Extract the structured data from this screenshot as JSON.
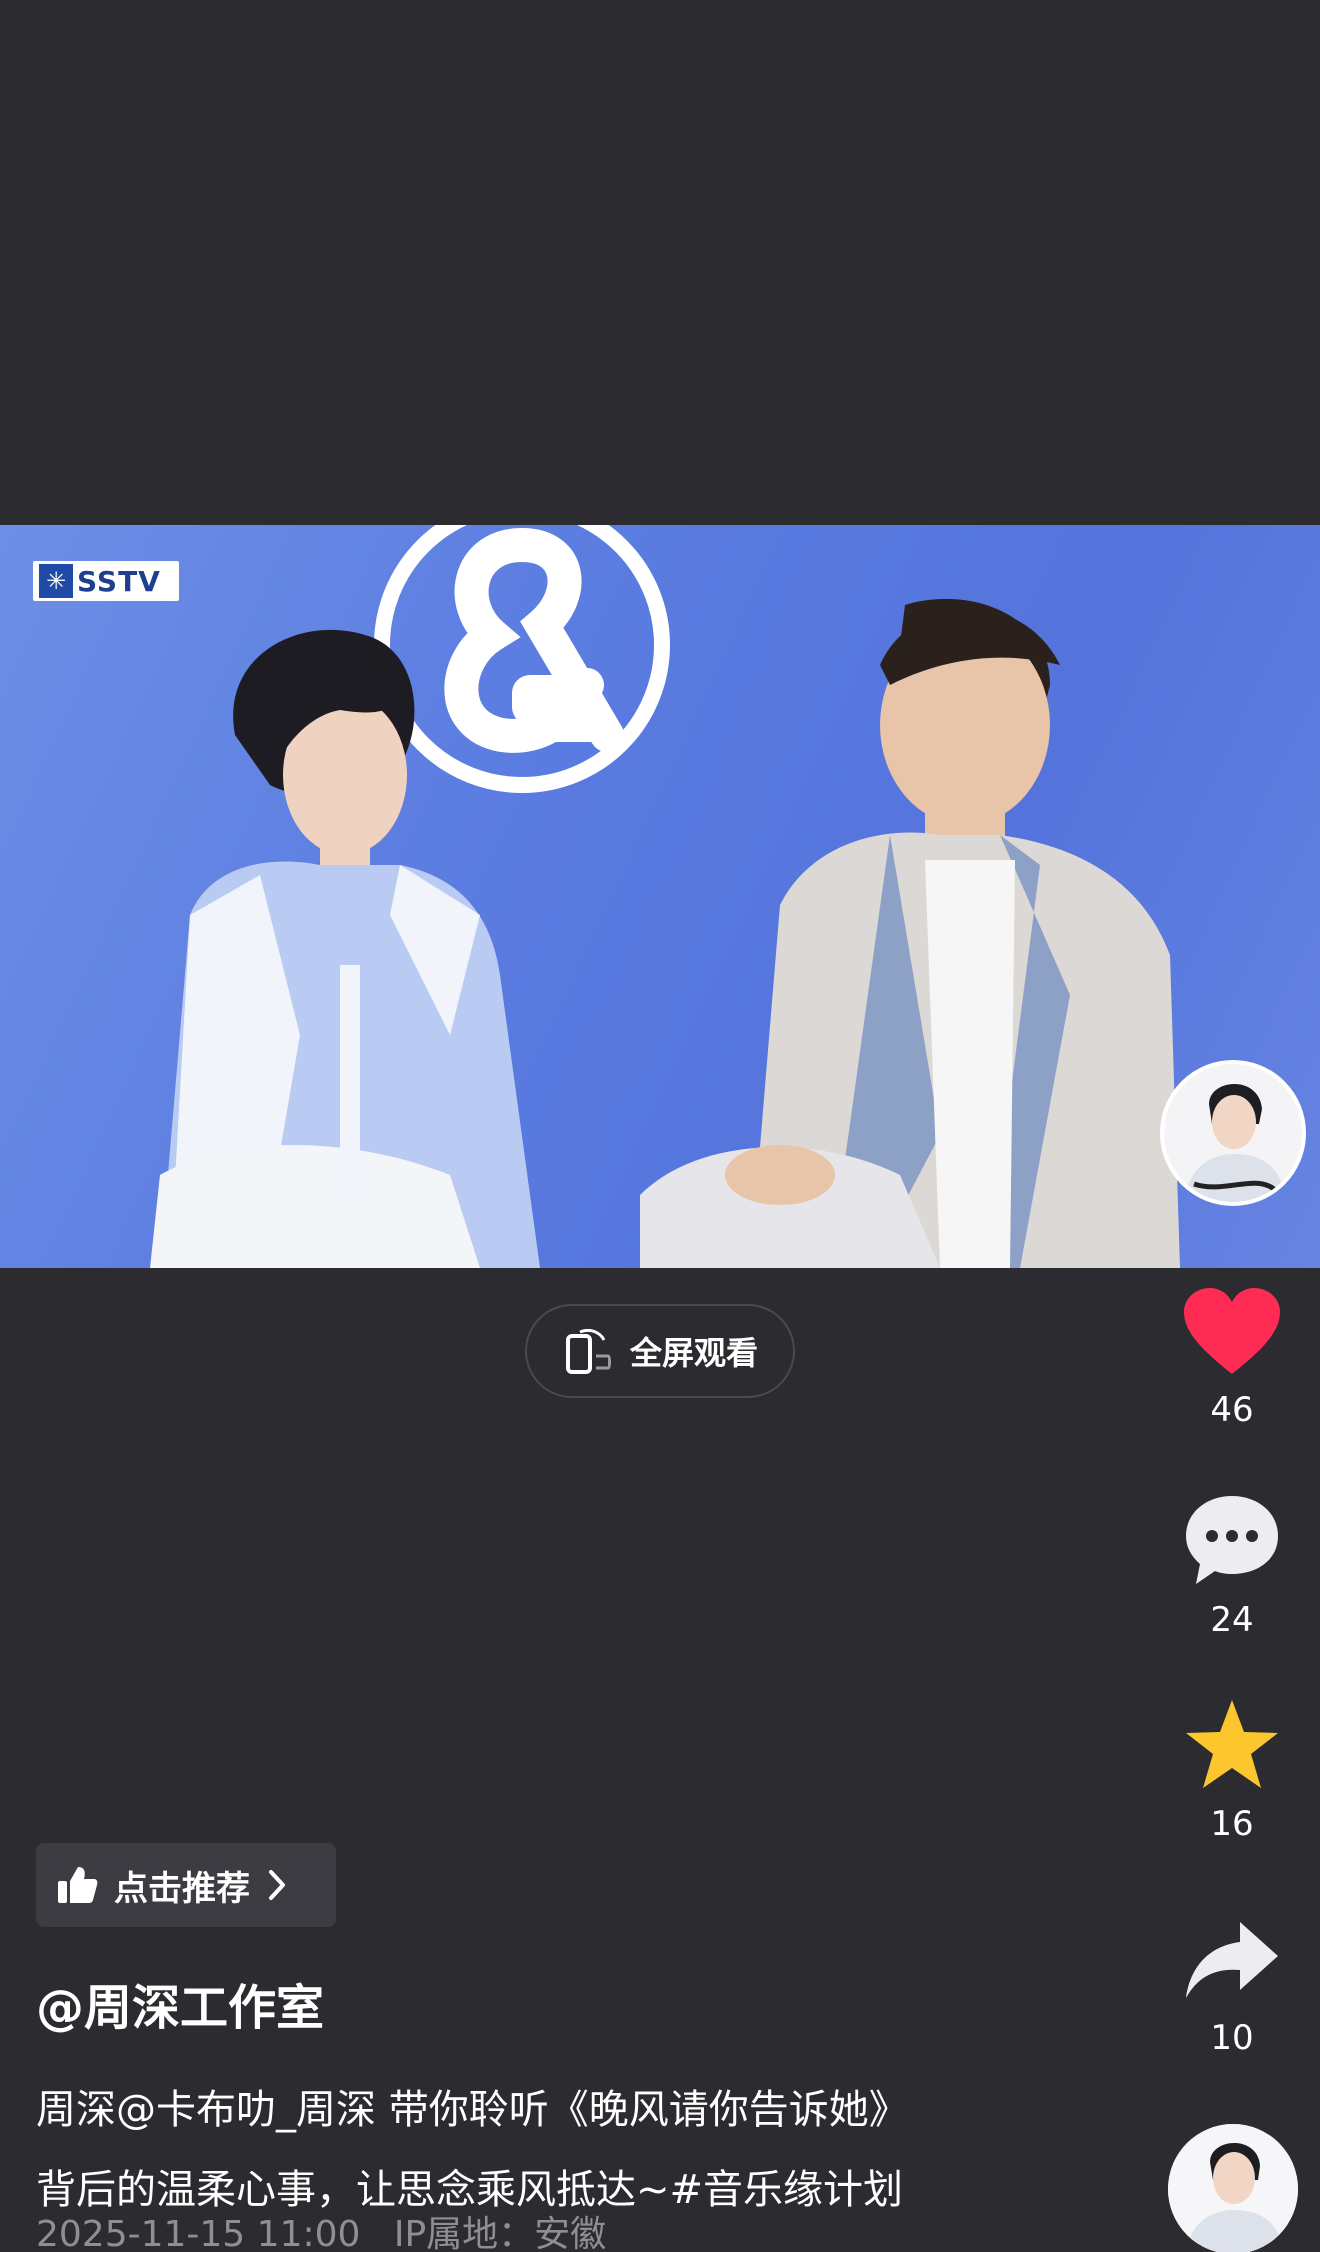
{
  "video": {
    "watermark": "SSTV"
  },
  "fullscreen": {
    "label": "全屏观看"
  },
  "actions": {
    "like_count": "46",
    "comment_count": "24",
    "favorite_count": "16",
    "share_count": "10"
  },
  "recommend": {
    "label": "点击推荐"
  },
  "post": {
    "author": "@周深工作室",
    "caption_line1": "周深@卡布叻_周深  带你聆听《晚风请你告诉她》",
    "caption_line2": "背后的温柔心事，让思念乘风抵达~#音乐缘计划",
    "date": "2025-11-15 11:00",
    "ip_location": "IP属地：安徽"
  },
  "icons": {
    "like": "heart-icon",
    "comment": "comment-bubble-icon",
    "favorite": "star-icon",
    "share": "share-arrow-icon",
    "fullscreen": "rotate-screen-icon",
    "recommend": "thumbs-up-icon",
    "chevron": "chevron-right-icon"
  },
  "colors": {
    "background": "#2b2b30",
    "like": "#fe2c55",
    "favorite": "#fcc62e",
    "video_bg": "#5a7be0"
  }
}
